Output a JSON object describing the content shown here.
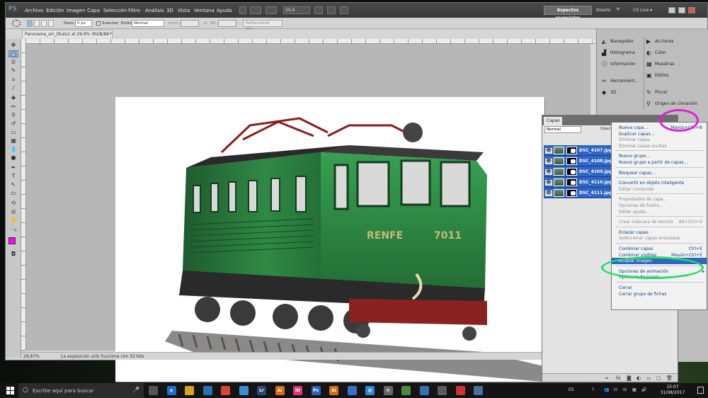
{
  "app": {
    "logo": "PS"
  },
  "menu": [
    "Archivo",
    "Edición",
    "Imagen",
    "Capa",
    "Selección",
    "Filtro",
    "Análisis",
    "3D",
    "Vista",
    "Ventana",
    "Ayuda"
  ],
  "zoom_select": "29,9",
  "workspace": {
    "active": "Aspectos esenciales",
    "second": "Diseño",
    "more": "»",
    "cs_live": "CS Live ▾"
  },
  "options_bar": {
    "feather_label": "Desv.:",
    "feather_value": "0 px",
    "antialias_label": "Suavizar",
    "style_label": "Estilo:",
    "style_value": "Normal",
    "width_label": "Anch.:",
    "height_label": "Alt.:",
    "refine_button": "Perfeccionar bor..."
  },
  "document": {
    "tab_title": "Panorama_sin_título1 al 29,9% (RGB/8) *",
    "zoom_status": "29,87%",
    "status_text": "La exposición sólo funciona con 32 bits"
  },
  "dock": {
    "col1": [
      {
        "label": "Navegador",
        "icon": "navigator-icon"
      },
      {
        "label": "Histograma",
        "icon": "histogram-icon"
      },
      {
        "label": "Información",
        "icon": "info-icon"
      },
      {
        "label": "Herramient...",
        "icon": "tool-presets-icon"
      },
      {
        "label": "3D",
        "icon": "3d-icon"
      }
    ],
    "col2": [
      {
        "label": "Acciones",
        "icon": "actions-icon"
      },
      {
        "label": "Color",
        "icon": "color-icon"
      },
      {
        "label": "Muestras",
        "icon": "swatches-icon"
      },
      {
        "label": "Estilos",
        "icon": "styles-icon"
      },
      {
        "label": "Pincel",
        "icon": "brush-icon"
      },
      {
        "label": "Origen de clonación",
        "icon": "clone-source-icon"
      }
    ]
  },
  "layers": {
    "tab": "Capas",
    "blend_mode": "Normal",
    "opacity_label": "Opaci",
    "items": [
      "DSC_4107.jpg",
      "DSC_4108.jpg",
      "DSC_4109.jpg",
      "DSC_4110.jpg",
      "DSC_4111.jpg"
    ]
  },
  "context_menu": {
    "items": [
      {
        "label": "Nueva capa...",
        "shortcut": "Mayús+Ctrl+N",
        "state": "enabled"
      },
      {
        "label": "Duplicar capas...",
        "shortcut": "",
        "state": "enabled"
      },
      {
        "label": "Eliminar capas",
        "shortcut": "",
        "state": "disabled"
      },
      {
        "label": "Eliminar capas ocultas",
        "shortcut": "",
        "state": "disabled"
      },
      {
        "label": "Nuevo grupo...",
        "shortcut": "",
        "state": "enabled"
      },
      {
        "label": "Nuevo grupo a partir de capas...",
        "shortcut": "",
        "state": "enabled"
      },
      {
        "label": "Bloquear capas...",
        "shortcut": "",
        "state": "enabled"
      },
      {
        "label": "Convertir en objeto inteligente",
        "shortcut": "",
        "state": "enabled"
      },
      {
        "label": "Editar contenido",
        "shortcut": "",
        "state": "disabled"
      },
      {
        "label": "Propiedades de capa...",
        "shortcut": "",
        "state": "disabled"
      },
      {
        "label": "Opciones de fusión...",
        "shortcut": "",
        "state": "disabled"
      },
      {
        "label": "Editar ajuste...",
        "shortcut": "",
        "state": "disabled"
      },
      {
        "label": "Crear máscara de recorte",
        "shortcut": "Alt+Ctrl+G",
        "state": "disabled"
      },
      {
        "label": "Enlazar capas",
        "shortcut": "",
        "state": "enabled"
      },
      {
        "label": "Seleccionar capas enlazadas",
        "shortcut": "",
        "state": "disabled"
      },
      {
        "label": "Combinar capas",
        "shortcut": "Ctrl+E",
        "state": "enabled"
      },
      {
        "label": "Combinar visibles",
        "shortcut": "Mayús+Ctrl+E",
        "state": "enabled"
      },
      {
        "label": "Acoplar imagen",
        "shortcut": "",
        "state": "highlighted"
      },
      {
        "label": "Opciones de animación",
        "shortcut": "",
        "state": "enabled",
        "submenu": true
      },
      {
        "label": "Opciones de panel...",
        "shortcut": "",
        "state": "enabled"
      },
      {
        "label": "Cerrar",
        "shortcut": "",
        "state": "enabled"
      },
      {
        "label": "Cerrar grupo de fichas",
        "shortcut": "",
        "state": "enabled"
      }
    ]
  },
  "locomotive": {
    "lettering": "RENFE",
    "number": "7011"
  },
  "taskbar": {
    "search_placeholder": "Escribe aquí para buscar",
    "apps": [
      {
        "icon": "task-view-icon",
        "label": ""
      },
      {
        "icon": "edge-icon",
        "label": "e"
      },
      {
        "icon": "explorer-icon",
        "label": ""
      },
      {
        "icon": "store-icon",
        "label": ""
      },
      {
        "icon": "chrome-icon",
        "label": ""
      },
      {
        "icon": "app-icon",
        "label": ""
      },
      {
        "icon": "lightroom-icon",
        "label": "Lr"
      },
      {
        "icon": "illustrator-icon",
        "label": "Ai"
      },
      {
        "icon": "indesign-icon",
        "label": "ID"
      },
      {
        "icon": "photoshop-icon",
        "label": "Ps"
      },
      {
        "icon": "illustrator-icon",
        "label": "Ai"
      },
      {
        "icon": "mail-icon",
        "label": ""
      },
      {
        "icon": "at-icon",
        "label": "@"
      },
      {
        "icon": "settings-icon",
        "label": "⚙"
      },
      {
        "icon": "app-icon",
        "label": ""
      },
      {
        "icon": "app-icon",
        "label": ""
      },
      {
        "icon": "app-icon",
        "label": ""
      },
      {
        "icon": "app-icon",
        "label": ""
      },
      {
        "icon": "photos-icon",
        "label": ""
      }
    ],
    "lang": "ES",
    "time": "15:07",
    "date": "31/08/2017"
  },
  "colors": {
    "annotation_magenta": "#e020d8",
    "annotation_green": "#22dd66",
    "selection_blue": "#2f65c4",
    "foreground_swatch": "#ff00ff",
    "background_swatch": "#00cc44"
  }
}
